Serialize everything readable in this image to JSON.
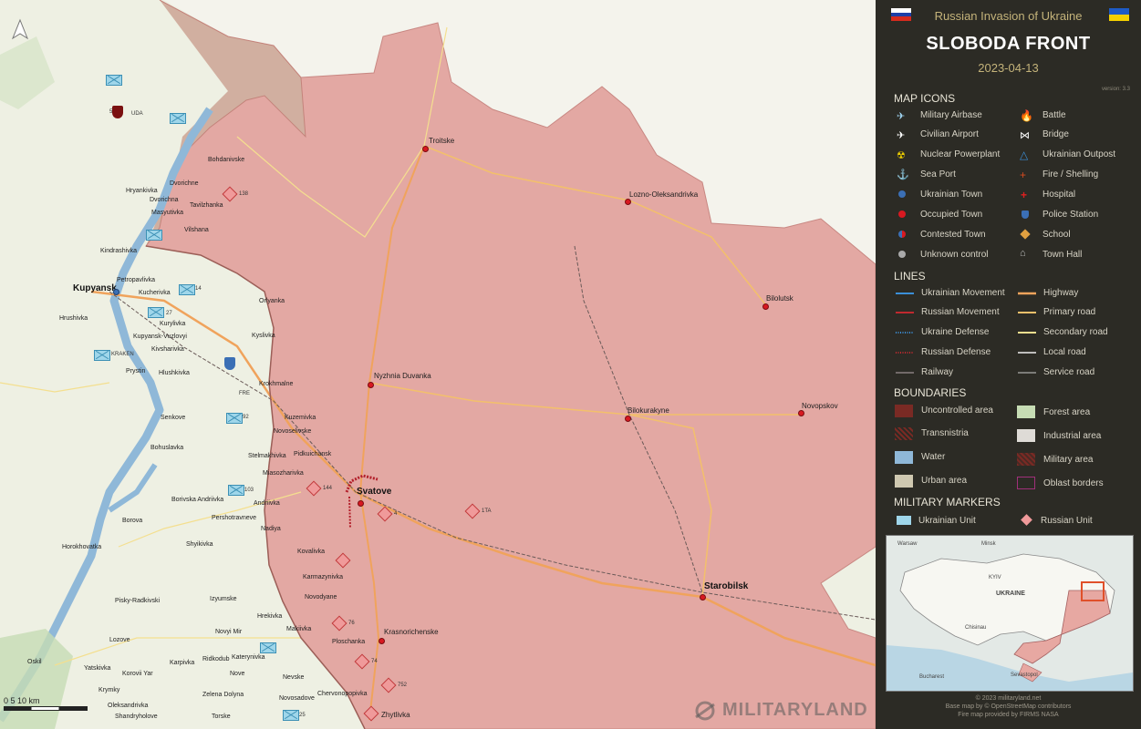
{
  "header": {
    "suptitle": "Russian Invasion of Ukraine",
    "title": "SLOBODA FRONT",
    "date": "2023-04-13",
    "version": "version: 3.3"
  },
  "map": {
    "towns_big": [
      "Kupyansk",
      "Svatove",
      "Starobilsk"
    ],
    "towns_occupied": [
      "Troitske",
      "Lozno-Oleksandrivka",
      "Bilolutsk",
      "Nyzhnia Duvanka",
      "Bilokurakyne",
      "Novopskov",
      "Krasnorichenske",
      "Zhytlivka"
    ],
    "towns_west": [
      "Bohdanivske",
      "Dvorichne",
      "Hryankivka",
      "Dvorichna",
      "Tavilzhanka",
      "Masyutivka",
      "Vilshana",
      "Kindrashivka",
      "Petropavlivka",
      "Kucherivka",
      "Hrushivka",
      "Kurylivka",
      "Kupyansk-Vuzlovyi",
      "Kivsharivka",
      "Prystin",
      "Hlushkivka",
      "Orlyanka",
      "Kyslivka",
      "Krokhmalne",
      "Kuzemivka",
      "Novoselivske",
      "Senkove",
      "Bohuslavka",
      "Stelmakhivka",
      "Pidkuichansk",
      "Miasozharivka",
      "Andriivka",
      "Borivska Andriivka",
      "Pershotravneve",
      "Nadiya",
      "Borova",
      "Horokhovatka",
      "Shyikivka",
      "Kovalivka",
      "Karmazynivka",
      "Novodyane",
      "Pisky-Radkivski",
      "Izyumske",
      "Hrekivka",
      "Novyi Mir",
      "Makiivka",
      "Lozove",
      "Ploschanka",
      "Oskil",
      "Ridkodub",
      "Katerynivka",
      "Yatskivka",
      "Korovii Yar",
      "Karpivka",
      "Nove",
      "Nevske",
      "Krymky",
      "Zelena Dolyna",
      "Oleksandrivka",
      "Chervonopopivka",
      "Novosadove",
      "Shandryholove",
      "Torske"
    ],
    "ua_units": [
      "5",
      "92",
      "103",
      "14",
      "27",
      "25"
    ],
    "ru_units": [
      "138",
      "144",
      "4",
      "1TA",
      "752",
      "74",
      "76"
    ],
    "scale": "0  5  10 km",
    "unit_tags": [
      "UDA",
      "KRAKEN",
      "FRE"
    ],
    "logo": "MILITARYLAND"
  },
  "legend": {
    "sections": {
      "icons": "MAP ICONS",
      "lines": "LINES",
      "boundaries": "BOUNDARIES",
      "markers": "MILITARY MARKERS"
    },
    "icons_left": [
      "Military Airbase",
      "Civilian Airport",
      "Nuclear Powerplant",
      "Sea Port",
      "Ukrainian Town",
      "Occupied Town",
      "Contested Town",
      "Unknown control"
    ],
    "icons_right": [
      "Battle",
      "Bridge",
      "Ukrainian Outpost",
      "Fire / Shelling",
      "Hospital",
      "Police Station",
      "School",
      "Town Hall"
    ],
    "lines_left": [
      "Ukrainian Movement",
      "Russian Movement",
      "Ukraine Defense",
      "Russian Defense",
      "Railway"
    ],
    "lines_right": [
      "Highway",
      "Primary road",
      "Secondary road",
      "Local road",
      "Service road"
    ],
    "boundaries_left": [
      "Uncontrolled area",
      "Transnistria",
      "Water",
      "Urban area"
    ],
    "boundaries_right": [
      "Forest area",
      "Industrial area",
      "Military area",
      "Oblast borders"
    ],
    "markers": [
      "Ukrainian Unit",
      "Russian Unit"
    ],
    "colors": {
      "occupied": "#e8a4a0",
      "ukrainian": "#3b6fb5",
      "russian": "#d81921",
      "highway": "#f0a35c",
      "primary": "#f3c06b",
      "secondary": "#f4df8f"
    }
  },
  "inset": {
    "labels": [
      "Warsaw",
      "KYIV",
      "UKRAINE",
      "Bucharest",
      "Sevastopol",
      "Chisinau",
      "Minsk"
    ]
  },
  "footer": {
    "line1": "© 2023 militaryland.net",
    "line2": "Base map by © OpenStreetMap contributors",
    "line3": "Fire map provided by FIRMS NASA"
  }
}
